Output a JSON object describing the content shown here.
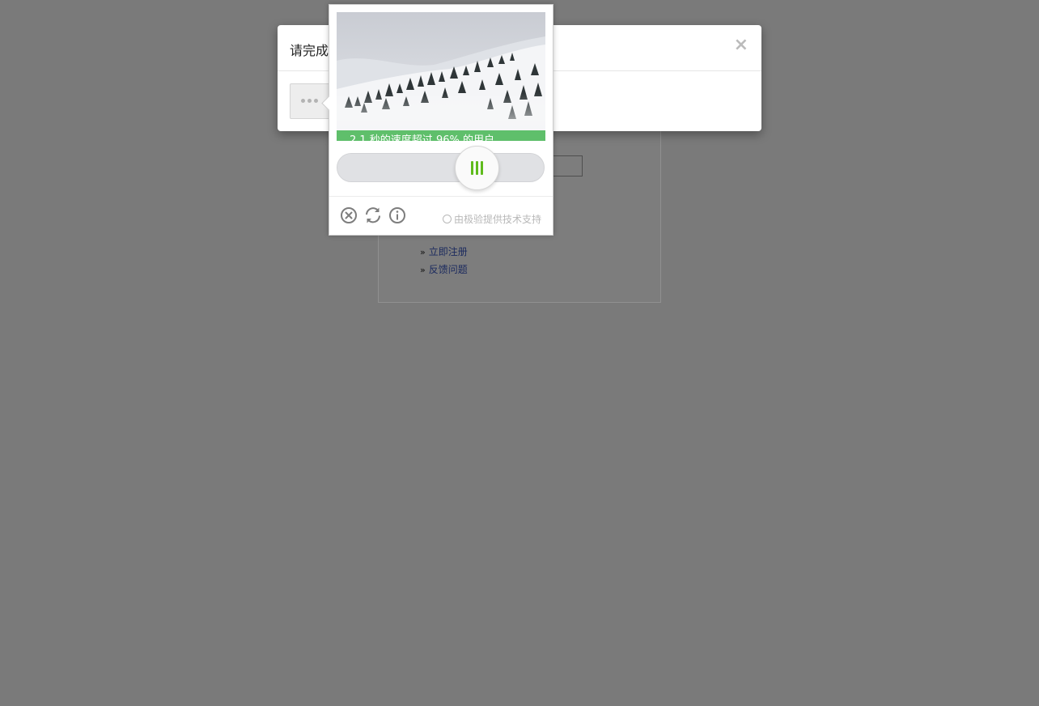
{
  "background_login": {
    "links": [
      {
        "chevron": "»",
        "label": "立即注册"
      },
      {
        "chevron": "»",
        "label": "反馈问题"
      }
    ]
  },
  "modal": {
    "title": "请完成",
    "close_icon": "×"
  },
  "captcha": {
    "success_message": "2.1 秒的速度超过 96% 的用户",
    "slider_progress": 0.6,
    "footer": {
      "close_icon": "close-circle-icon",
      "refresh_icon": "refresh-icon",
      "info_icon": "info-icon",
      "powered_by": "由极验提供技术支持"
    }
  },
  "colors": {
    "overlay": "#7a7a7a",
    "success_green": "#5fbf6b",
    "knob_accent": "#5fbb1c"
  }
}
